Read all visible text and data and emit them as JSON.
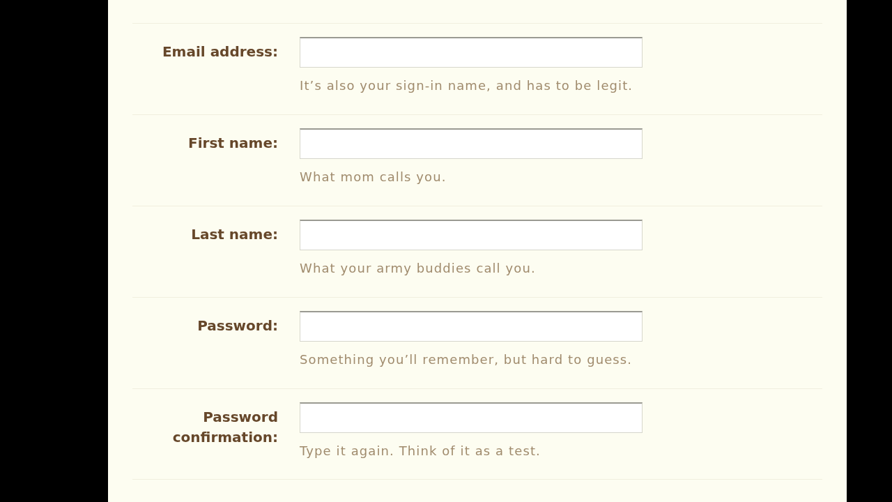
{
  "form": {
    "fields": [
      {
        "label": "Email address:",
        "hint": "It’s also your sign-in name, and has to be legit."
      },
      {
        "label": "First name:",
        "hint": "What mom calls you."
      },
      {
        "label": "Last name:",
        "hint": "What your army buddies call you."
      },
      {
        "label": "Password:",
        "hint": "Something you’ll remember, but hard to guess."
      },
      {
        "label": "Password confirmation:",
        "hint": "Type it again. Think of it as a test."
      }
    ]
  }
}
